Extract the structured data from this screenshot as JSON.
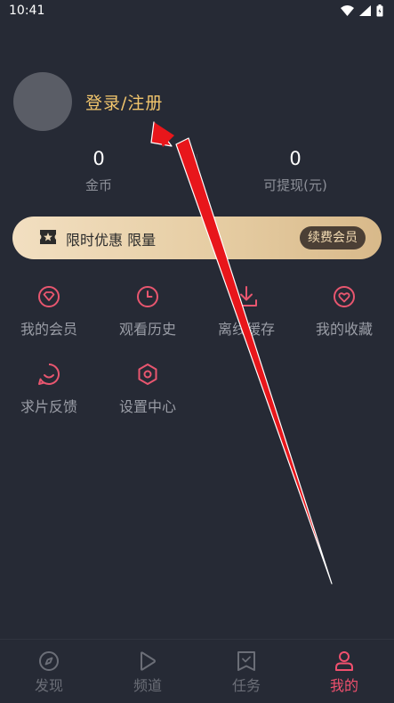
{
  "status_bar": {
    "time": "10:41"
  },
  "profile": {
    "login_label": "登录/注册"
  },
  "stats": [
    {
      "value": "0",
      "label": "金币"
    },
    {
      "value": "0",
      "label": "可提现(元)"
    }
  ],
  "vip_banner": {
    "text": "限时优惠 限量",
    "button_label": "续费会员"
  },
  "menu": [
    {
      "label": "我的会员",
      "icon": "diamond-icon"
    },
    {
      "label": "观看历史",
      "icon": "clock-icon"
    },
    {
      "label": "离线缓存",
      "icon": "download-icon"
    },
    {
      "label": "我的收藏",
      "icon": "heart-icon"
    },
    {
      "label": "求片反馈",
      "icon": "feedback-icon"
    },
    {
      "label": "设置中心",
      "icon": "settings-icon"
    }
  ],
  "bottom_nav": [
    {
      "label": "发现",
      "icon": "compass-icon",
      "active": false
    },
    {
      "label": "频道",
      "icon": "play-icon",
      "active": false
    },
    {
      "label": "任务",
      "icon": "task-icon",
      "active": false
    },
    {
      "label": "我的",
      "icon": "profile-icon",
      "active": true
    }
  ],
  "colors": {
    "background": "#262a35",
    "accent": "#f0506e",
    "menu_icon": "#e8566f",
    "login_text": "#f2c66d",
    "annotation_arrow": "#e8161b"
  }
}
